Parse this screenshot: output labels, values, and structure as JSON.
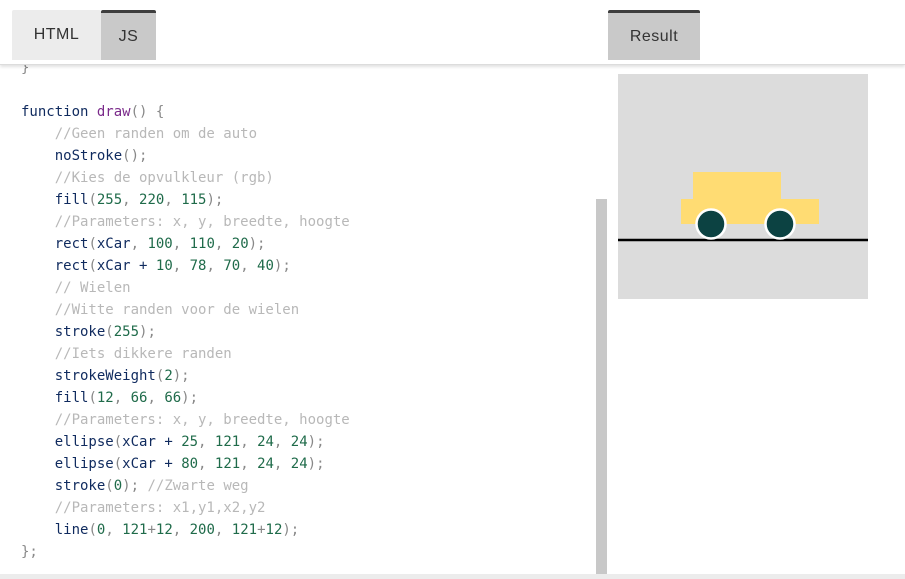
{
  "tabs": {
    "html_label": "HTML",
    "js_label": "JS",
    "result_label": "Result"
  },
  "code_lines": [
    [
      {
        "t": "}",
        "c": "punc"
      }
    ],
    [],
    [
      {
        "t": "function ",
        "c": "kw"
      },
      {
        "t": "draw",
        "c": "fn"
      },
      {
        "t": "() {",
        "c": "punc"
      }
    ],
    [
      {
        "t": "    "
      },
      {
        "t": "//Geen randen om de auto",
        "c": "cm"
      }
    ],
    [
      {
        "t": "    "
      },
      {
        "t": "noStroke",
        "c": "call"
      },
      {
        "t": "();",
        "c": "punc"
      }
    ],
    [
      {
        "t": "    "
      },
      {
        "t": "//Kies de opvulkleur (rgb)",
        "c": "cm"
      }
    ],
    [
      {
        "t": "    "
      },
      {
        "t": "fill",
        "c": "call"
      },
      {
        "t": "(",
        "c": "punc"
      },
      {
        "t": "255",
        "c": "num"
      },
      {
        "t": ", ",
        "c": "punc"
      },
      {
        "t": "220",
        "c": "num"
      },
      {
        "t": ", ",
        "c": "punc"
      },
      {
        "t": "115",
        "c": "num"
      },
      {
        "t": ");",
        "c": "punc"
      }
    ],
    [
      {
        "t": "    "
      },
      {
        "t": "//Parameters: x, y, breedte, hoogte",
        "c": "cm"
      }
    ],
    [
      {
        "t": "    "
      },
      {
        "t": "rect",
        "c": "call"
      },
      {
        "t": "(",
        "c": "punc"
      },
      {
        "t": "xCar",
        "c": "var"
      },
      {
        "t": ", ",
        "c": "punc"
      },
      {
        "t": "100",
        "c": "num"
      },
      {
        "t": ", ",
        "c": "punc"
      },
      {
        "t": "110",
        "c": "num"
      },
      {
        "t": ", ",
        "c": "punc"
      },
      {
        "t": "20",
        "c": "num"
      },
      {
        "t": ");",
        "c": "punc"
      }
    ],
    [
      {
        "t": "    "
      },
      {
        "t": "rect",
        "c": "call"
      },
      {
        "t": "(",
        "c": "punc"
      },
      {
        "t": "xCar + ",
        "c": "var"
      },
      {
        "t": "10",
        "c": "num"
      },
      {
        "t": ", ",
        "c": "punc"
      },
      {
        "t": "78",
        "c": "num"
      },
      {
        "t": ", ",
        "c": "punc"
      },
      {
        "t": "70",
        "c": "num"
      },
      {
        "t": ", ",
        "c": "punc"
      },
      {
        "t": "40",
        "c": "num"
      },
      {
        "t": ");",
        "c": "punc"
      }
    ],
    [
      {
        "t": "    "
      },
      {
        "t": "// Wielen",
        "c": "cm"
      }
    ],
    [
      {
        "t": "    "
      },
      {
        "t": "//Witte randen voor de wielen",
        "c": "cm"
      }
    ],
    [
      {
        "t": "    "
      },
      {
        "t": "stroke",
        "c": "call"
      },
      {
        "t": "(",
        "c": "punc"
      },
      {
        "t": "255",
        "c": "num"
      },
      {
        "t": ");",
        "c": "punc"
      }
    ],
    [
      {
        "t": "    "
      },
      {
        "t": "//Iets dikkere randen",
        "c": "cm"
      }
    ],
    [
      {
        "t": "    "
      },
      {
        "t": "strokeWeight",
        "c": "call"
      },
      {
        "t": "(",
        "c": "punc"
      },
      {
        "t": "2",
        "c": "num"
      },
      {
        "t": ");",
        "c": "punc"
      }
    ],
    [
      {
        "t": "    "
      },
      {
        "t": "fill",
        "c": "call"
      },
      {
        "t": "(",
        "c": "punc"
      },
      {
        "t": "12",
        "c": "num"
      },
      {
        "t": ", ",
        "c": "punc"
      },
      {
        "t": "66",
        "c": "num"
      },
      {
        "t": ", ",
        "c": "punc"
      },
      {
        "t": "66",
        "c": "num"
      },
      {
        "t": ");",
        "c": "punc"
      }
    ],
    [
      {
        "t": "    "
      },
      {
        "t": "//Parameters: x, y, breedte, hoogte",
        "c": "cm"
      }
    ],
    [
      {
        "t": "    "
      },
      {
        "t": "ellipse",
        "c": "call"
      },
      {
        "t": "(",
        "c": "punc"
      },
      {
        "t": "xCar + ",
        "c": "var"
      },
      {
        "t": "25",
        "c": "num"
      },
      {
        "t": ", ",
        "c": "punc"
      },
      {
        "t": "121",
        "c": "num"
      },
      {
        "t": ", ",
        "c": "punc"
      },
      {
        "t": "24",
        "c": "num"
      },
      {
        "t": ", ",
        "c": "punc"
      },
      {
        "t": "24",
        "c": "num"
      },
      {
        "t": ");",
        "c": "punc"
      }
    ],
    [
      {
        "t": "    "
      },
      {
        "t": "ellipse",
        "c": "call"
      },
      {
        "t": "(",
        "c": "punc"
      },
      {
        "t": "xCar + ",
        "c": "var"
      },
      {
        "t": "80",
        "c": "num"
      },
      {
        "t": ", ",
        "c": "punc"
      },
      {
        "t": "121",
        "c": "num"
      },
      {
        "t": ", ",
        "c": "punc"
      },
      {
        "t": "24",
        "c": "num"
      },
      {
        "t": ", ",
        "c": "punc"
      },
      {
        "t": "24",
        "c": "num"
      },
      {
        "t": ");",
        "c": "punc"
      }
    ],
    [
      {
        "t": "    "
      },
      {
        "t": "stroke",
        "c": "call"
      },
      {
        "t": "(",
        "c": "punc"
      },
      {
        "t": "0",
        "c": "num"
      },
      {
        "t": "); ",
        "c": "punc"
      },
      {
        "t": "//Zwarte weg",
        "c": "cm"
      }
    ],
    [
      {
        "t": "    "
      },
      {
        "t": "//Parameters: x1,y1,x2,y2",
        "c": "cm"
      }
    ],
    [
      {
        "t": "    "
      },
      {
        "t": "line",
        "c": "call"
      },
      {
        "t": "(",
        "c": "punc"
      },
      {
        "t": "0",
        "c": "num"
      },
      {
        "t": ", ",
        "c": "punc"
      },
      {
        "t": "121",
        "c": "num"
      },
      {
        "t": "+",
        "c": "punc"
      },
      {
        "t": "12",
        "c": "num"
      },
      {
        "t": ", ",
        "c": "punc"
      },
      {
        "t": "200",
        "c": "num"
      },
      {
        "t": ", ",
        "c": "punc"
      },
      {
        "t": "121",
        "c": "num"
      },
      {
        "t": "+",
        "c": "punc"
      },
      {
        "t": "12",
        "c": "num"
      },
      {
        "t": ");",
        "c": "punc"
      }
    ],
    [
      {
        "t": "};",
        "c": "punc"
      }
    ]
  ],
  "colors": {
    "canvas_bg": "#dcdcdc",
    "car_body": "#ffdc73",
    "wheel_fill": "#0c4242",
    "wheel_stroke": "#ffffff",
    "road": "#000000"
  }
}
